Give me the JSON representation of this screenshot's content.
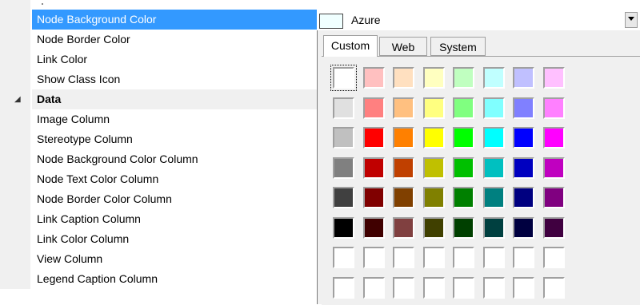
{
  "property_grid": {
    "rows": [
      {
        "label": "Node Background Color",
        "selected": true
      },
      {
        "label": "Node Border Color"
      },
      {
        "label": "Link Color"
      },
      {
        "label": "Show Class Icon"
      },
      {
        "label": "Data",
        "category": true
      },
      {
        "label": "Image Column"
      },
      {
        "label": "Stereotype Column"
      },
      {
        "label": "Node Background Color Column"
      },
      {
        "label": "Node Text Color Column"
      },
      {
        "label": "Node Border Color Column"
      },
      {
        "label": "Link Caption Column"
      },
      {
        "label": "Link Color Column"
      },
      {
        "label": "View Column"
      },
      {
        "label": "Legend Caption Column"
      }
    ]
  },
  "value_editor": {
    "color_name": "Azure",
    "swatch_color": "#f0ffff"
  },
  "color_picker": {
    "tabs": [
      {
        "label": "Custom",
        "active": true
      },
      {
        "label": "Web"
      },
      {
        "label": "System"
      }
    ],
    "palette": [
      [
        "#ffffff",
        "#ffc0c0",
        "#ffe0c0",
        "#ffffc0",
        "#c0ffc0",
        "#c0ffff",
        "#c0c0ff",
        "#ffc0ff"
      ],
      [
        "#e0e0e0",
        "#ff8080",
        "#ffc080",
        "#ffff80",
        "#80ff80",
        "#80ffff",
        "#8080ff",
        "#ff80ff"
      ],
      [
        "#c0c0c0",
        "#ff0000",
        "#ff8000",
        "#ffff00",
        "#00ff00",
        "#00ffff",
        "#0000ff",
        "#ff00ff"
      ],
      [
        "#808080",
        "#c00000",
        "#c04000",
        "#c0c000",
        "#00c000",
        "#00c0c0",
        "#0000c0",
        "#c000c0"
      ],
      [
        "#404040",
        "#800000",
        "#804000",
        "#808000",
        "#008000",
        "#008080",
        "#000080",
        "#800080"
      ],
      [
        "#000000",
        "#400000",
        "#804040",
        "#404000",
        "#004000",
        "#004040",
        "#000040",
        "#400040"
      ],
      [
        "#ffffff",
        "#ffffff",
        "#ffffff",
        "#ffffff",
        "#ffffff",
        "#ffffff",
        "#ffffff",
        "#ffffff"
      ],
      [
        "#ffffff",
        "#ffffff",
        "#ffffff",
        "#ffffff",
        "#ffffff",
        "#ffffff",
        "#ffffff",
        "#ffffff"
      ]
    ],
    "selected_cell": [
      0,
      0
    ]
  }
}
